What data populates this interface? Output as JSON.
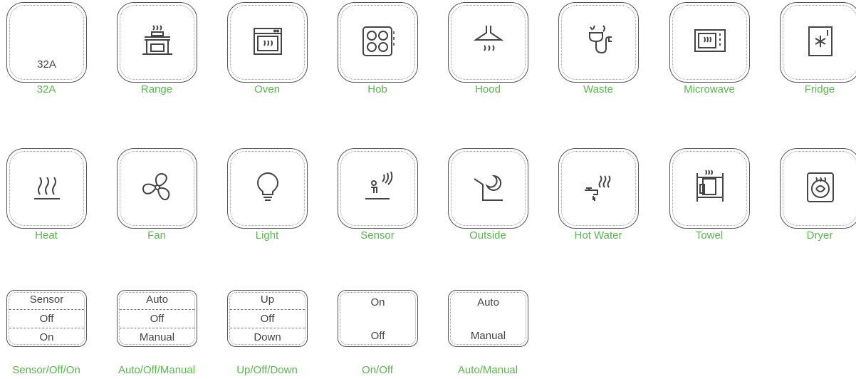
{
  "row1": [
    {
      "caption": "32A",
      "inner": "32A",
      "icon": "none"
    },
    {
      "caption": "Range",
      "icon": "range-icon"
    },
    {
      "caption": "Oven",
      "icon": "oven-icon"
    },
    {
      "caption": "Hob",
      "icon": "hob-icon"
    },
    {
      "caption": "Hood",
      "icon": "hood-icon"
    },
    {
      "caption": "Waste",
      "icon": "waste-icon"
    },
    {
      "caption": "Microwave",
      "icon": "microwave-icon"
    },
    {
      "caption": "Fridge",
      "icon": "fridge-icon"
    }
  ],
  "row2": [
    {
      "caption": "Heat",
      "icon": "heat-icon"
    },
    {
      "caption": "Fan",
      "icon": "fan-icon"
    },
    {
      "caption": "Light",
      "icon": "light-bulb-icon"
    },
    {
      "caption": "Sensor",
      "icon": "sensor-icon"
    },
    {
      "caption": "Outside",
      "icon": "outside-icon"
    },
    {
      "caption": "Hot Water",
      "icon": "hot-water-icon"
    },
    {
      "caption": "Towel",
      "icon": "towel-icon"
    },
    {
      "caption": "Dryer",
      "icon": "dryer-icon"
    }
  ],
  "row3": [
    {
      "caption": "Sensor/Off/On",
      "segments": [
        "Sensor",
        "Off",
        "On"
      ]
    },
    {
      "caption": "Auto/Off/Manual",
      "segments": [
        "Auto",
        "Off",
        "Manual"
      ]
    },
    {
      "caption": "Up/Off/Down",
      "segments": [
        "Up",
        "Off",
        "Down"
      ]
    },
    {
      "caption": "On/Off",
      "segments": [
        "On",
        "Off"
      ]
    },
    {
      "caption": "Auto/Manual",
      "segments": [
        "Auto",
        "Manual"
      ]
    }
  ],
  "colors": {
    "caption": "#58b94c",
    "line": "#555555",
    "text": "#444444"
  }
}
